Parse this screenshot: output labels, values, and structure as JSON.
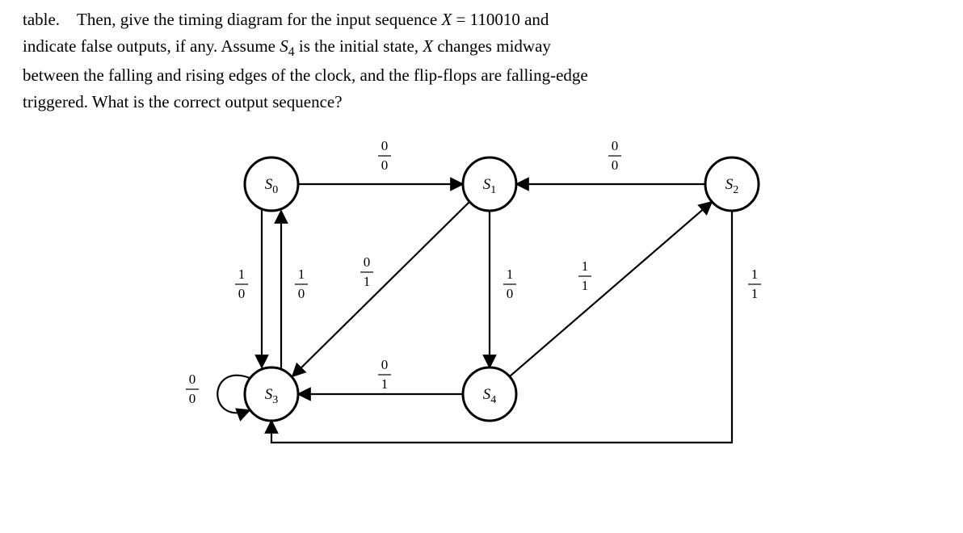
{
  "problem": {
    "line1_before": "table. Then, give the timing diagram for the input sequence ",
    "Xvar": "X",
    "eq": " = ",
    "seq": "110010",
    "line1_after": " and",
    "line2_before": "indicate false outputs, if any.  Assume ",
    "S4": "S",
    "S4sub": "4",
    "line2_after1": " is the initial state, ",
    "Xvar2": "X",
    "line2_after2": " changes midway",
    "line3": "between the falling and rising edges of the clock, and the flip-flops are falling-edge",
    "line4": "triggered.  What is the correct output sequence?"
  },
  "states": {
    "S0": "S",
    "S0sub": "0",
    "S1": "S",
    "S1sub": "1",
    "S2": "S",
    "S2sub": "2",
    "S3": "S",
    "S3sub": "3",
    "S4": "S",
    "S4sub": "4"
  },
  "edges": {
    "S0_S1": {
      "in": "0",
      "out": "0"
    },
    "S2_S1": {
      "in": "0",
      "out": "0"
    },
    "S0_S3_a": {
      "in": "1",
      "out": "0"
    },
    "S3_S0": {
      "in": "1",
      "out": "0"
    },
    "S1_S0": {
      "in": "0",
      "out": "1"
    },
    "S1_S4": {
      "in": "1",
      "out": "0"
    },
    "S4_S2": {
      "in": "1",
      "out": "1"
    },
    "S2_S3": {
      "in": "1",
      "out": "1"
    },
    "S4_S3": {
      "in": "0",
      "out": "1"
    },
    "S3_S3": {
      "in": "0",
      "out": "0"
    }
  }
}
